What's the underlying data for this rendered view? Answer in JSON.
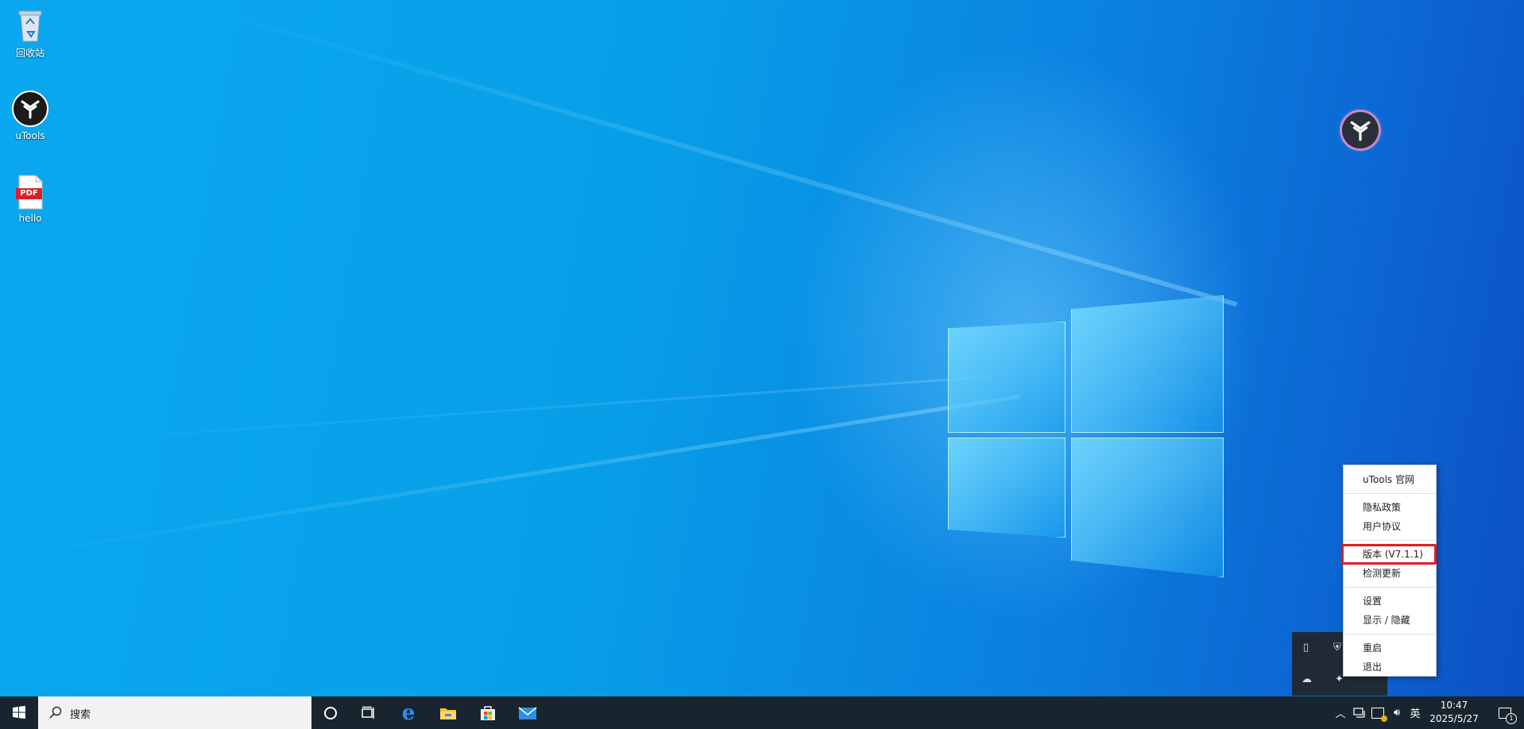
{
  "desktop": {
    "icons": [
      {
        "label": "回收站",
        "icon": "recycle-bin-icon"
      },
      {
        "label": "uTools",
        "icon": "utools-icon"
      },
      {
        "label": "hello",
        "icon": "pdf-file-icon",
        "badge": "PDF"
      }
    ]
  },
  "context_menu": {
    "items": [
      {
        "label": "uTools 官网"
      },
      {
        "label": "隐私政策"
      },
      {
        "label": "用户协议"
      },
      {
        "label": "版本 (V7.1.1)",
        "highlighted": true
      },
      {
        "label": "检测更新"
      },
      {
        "label": "设置"
      },
      {
        "label": "显示 / 隐藏"
      },
      {
        "label": "重启"
      },
      {
        "label": "退出"
      }
    ],
    "highlight_color": "#e21b24"
  },
  "taskbar": {
    "search_placeholder": "搜索",
    "ime_label": "英",
    "time": "10:47",
    "date": "2025/5/27",
    "notification_count": "1",
    "background": "#18252e"
  }
}
